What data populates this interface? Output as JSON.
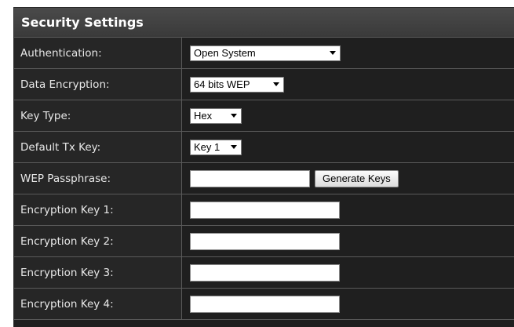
{
  "section": {
    "title": "Security Settings"
  },
  "fields": {
    "authentication": {
      "label": "Authentication:",
      "value": "Open System"
    },
    "data_encryption": {
      "label": "Data Encryption:",
      "value": "64 bits WEP"
    },
    "key_type": {
      "label": "Key Type:",
      "value": "Hex"
    },
    "default_tx_key": {
      "label": "Default Tx Key:",
      "value": "Key 1"
    },
    "wep_passphrase": {
      "label": "WEP Passphrase:",
      "value": "",
      "button": "Generate Keys"
    },
    "encryption_key_1": {
      "label": "Encryption Key 1:",
      "value": ""
    },
    "encryption_key_2": {
      "label": "Encryption Key 2:",
      "value": ""
    },
    "encryption_key_3": {
      "label": "Encryption Key 3:",
      "value": ""
    },
    "encryption_key_4": {
      "label": "Encryption Key 4:",
      "value": ""
    }
  },
  "colors": {
    "panel_background": "#1f1f1f",
    "title_bar": "#404040",
    "label_text": "#e8e8e8"
  }
}
